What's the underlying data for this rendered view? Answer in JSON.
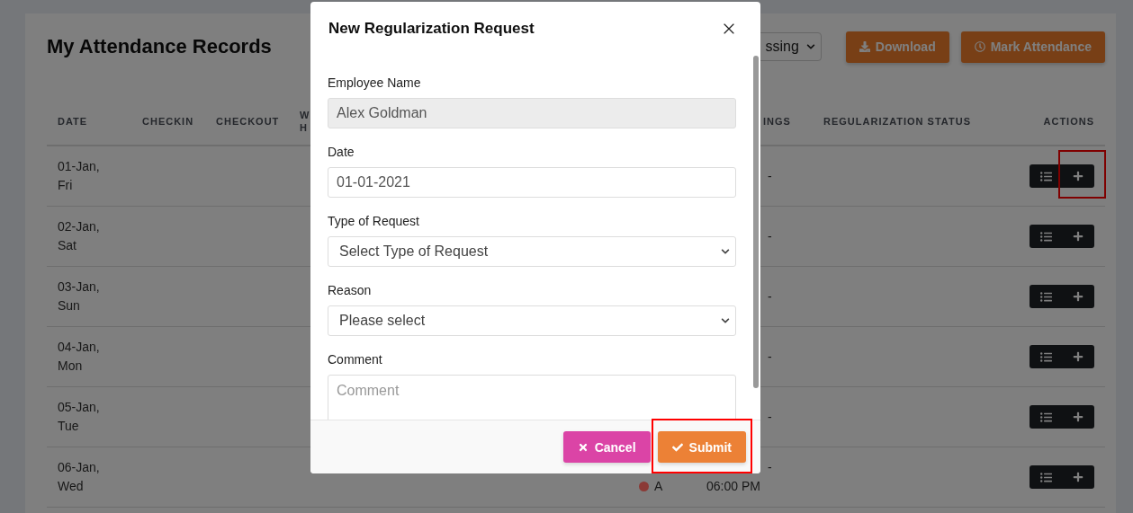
{
  "page": {
    "title": "My Attendance Records",
    "status_filter": {
      "value": "ssing"
    },
    "buttons": [
      {
        "kind": "download",
        "label": "Download"
      },
      {
        "kind": "mark",
        "label": "Mark Attendance"
      }
    ]
  },
  "table": {
    "columns": [
      "DATE",
      "CHECKIN",
      "CHECKOUT",
      "W H",
      "INGS",
      "REGULARIZATION STATUS",
      "ACTIONS"
    ],
    "rows": [
      {
        "date": "01-Jan, Fri",
        "timing_start": "-",
        "highlighted": true
      },
      {
        "date": "02-Jan, Sat",
        "timing_start": "-",
        "highlighted": false
      },
      {
        "date": "03-Jan, Sun",
        "timing_start": "-",
        "highlighted": false
      },
      {
        "date": "04-Jan, Mon",
        "timing_start": "-",
        "highlighted": false
      },
      {
        "date": "05-Jan, Tue",
        "timing_start": "-",
        "highlighted": false
      },
      {
        "date": "06-Jan, Wed",
        "attendance": {
          "label": "A",
          "color": "#8b3a36"
        },
        "timing_start": "-",
        "timing_end": "06:00 PM",
        "highlighted": false
      }
    ]
  },
  "modal": {
    "title": "New Regularization Request",
    "fields": [
      {
        "kind": "text",
        "label": "Employee Name",
        "value": "Alex Goldman",
        "disabled": true
      },
      {
        "kind": "text",
        "label": "Date",
        "value": "01-01-2021",
        "disabled": false
      },
      {
        "kind": "select",
        "label": "Type of Request",
        "value": "Select Type of Request"
      },
      {
        "kind": "select",
        "label": "Reason",
        "value": "Please select"
      },
      {
        "kind": "textarea",
        "label": "Comment",
        "placeholder": "Comment"
      }
    ],
    "buttons": [
      {
        "kind": "cancel",
        "label": "Cancel",
        "highlighted": false
      },
      {
        "kind": "submit",
        "label": "Submit",
        "highlighted": true
      }
    ]
  }
}
